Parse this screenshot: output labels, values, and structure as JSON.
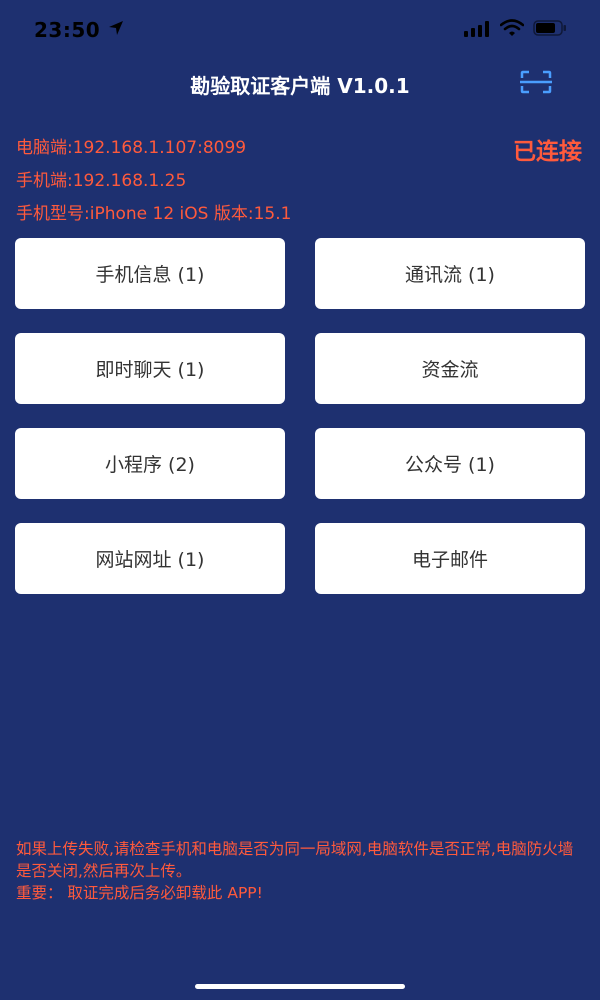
{
  "status_bar": {
    "time": "23:50"
  },
  "header": {
    "title": "勘验取证客户端 V1.0.1"
  },
  "connection": {
    "pc_line": "电脑端:192.168.1.107:8099",
    "phone_line": "手机端:192.168.1.25",
    "model_line": "手机型号:iPhone 12   iOS 版本:15.1",
    "status": "已连接"
  },
  "buttons": [
    {
      "label": "手机信息 (1)"
    },
    {
      "label": "通讯流 (1)"
    },
    {
      "label": "即时聊天 (1)"
    },
    {
      "label": "资金流"
    },
    {
      "label": "小程序 (2)"
    },
    {
      "label": "公众号 (1)"
    },
    {
      "label": "网站网址 (1)"
    },
    {
      "label": "电子邮件"
    }
  ],
  "footer": {
    "line1": "如果上传失败,请检查手机和电脑是否为同一局域网,电脑软件是否正常,电脑防火墙是否关闭,然后再次上传。",
    "line2": "重要： 取证完成后务必卸载此 APP!"
  },
  "colors": {
    "background": "#1e3070",
    "accent_text": "#ff5a3c",
    "scan_icon": "#4a9eff"
  }
}
